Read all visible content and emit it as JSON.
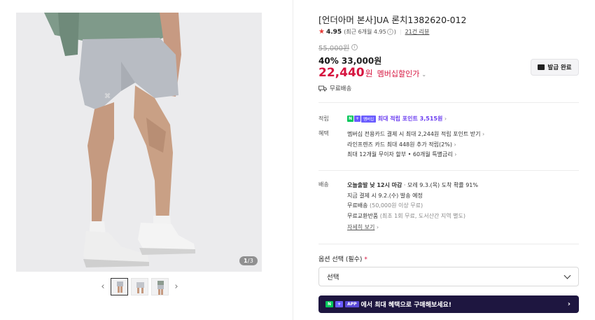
{
  "gallery": {
    "counter_current": "1",
    "counter_total": "3",
    "prev_icon": "chevron-left-icon",
    "next_icon": "chevron-right-icon"
  },
  "product": {
    "title": "[언더아머 본사]UA 론치1382620-012",
    "rating_score": "4.95",
    "rating_recent": "(최근 6개월 4.95",
    "rating_recent_close": ")",
    "review_link": "21건 리뷰",
    "original_price": "55,000원",
    "discount_pct": "40%",
    "discount_price": "33,000원",
    "member_price": "22,440",
    "member_won": "원",
    "member_label": "멤버십할인가",
    "coupon_button": "발급 완료",
    "shipping_free": "무료배송"
  },
  "benefits": {
    "points_label": "적립",
    "points_text": "최대 적립 포인트 3,515원",
    "benefit_label": "혜택",
    "benefit_lines": [
      "멤버십 전용카드 결제 시 최대 2,244원 적립 포인트 받기",
      "라인프렌즈 카드 최대 448원 추가 적립(2%)",
      "최대 12개월 무이자 할부 • 60개월 특별금리"
    ],
    "npill_n": "N",
    "npill_plus": "+",
    "npill_mem": "멤버십"
  },
  "delivery": {
    "label": "배송",
    "today": "오늘출발 낮 12시 마감",
    "arrival": "모레 9.3.(목) 도착 확률 91%",
    "dispatch": "지금 결제 시 9.2.(수) 발송 예정",
    "free_ship": "무료배송",
    "free_ship_note": "(50,000원 이상 무료)",
    "free_return": "무료교환반품",
    "free_return_note": "(최초 1회 무료, 도서산간 지역 별도)",
    "more_link": "자세히 보기"
  },
  "options": {
    "label": "옵션 선택 (필수)",
    "required_mark": "*",
    "select_value": "선택"
  },
  "promo": {
    "tag_n": "N",
    "tag_plus": "+",
    "tag_app": "APP",
    "text": "에서 최대 혜택으로 구매해보세요!",
    "arrow": "›"
  },
  "colors": {
    "accent_red": "#d6143f",
    "naver_green": "#03c75a",
    "membership_purple": "#6a5cff",
    "promo_bg": "#1e1640"
  }
}
